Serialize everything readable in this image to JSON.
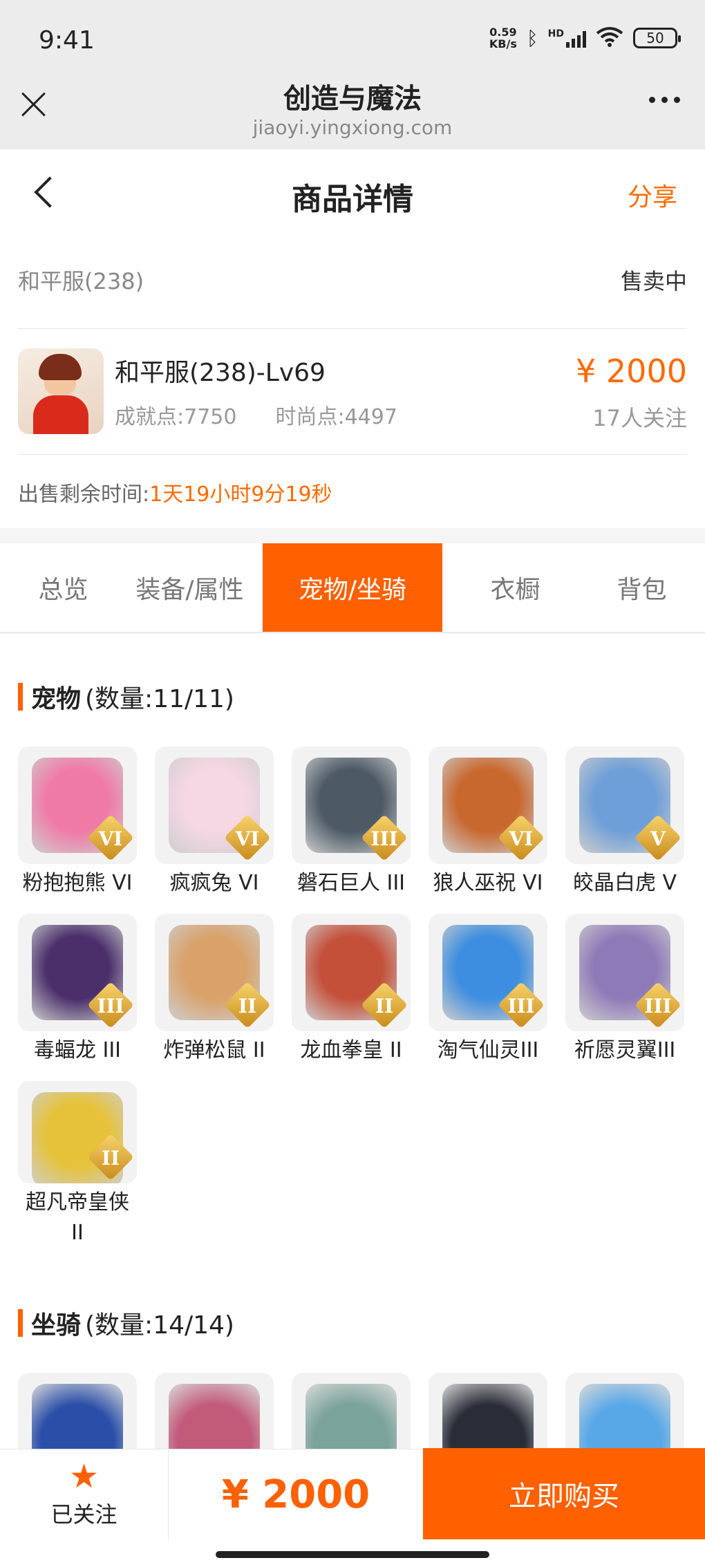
{
  "status_bar": {
    "time": "9:41",
    "net_speed": "0.59",
    "net_unit": "KB/s",
    "hd": "HD",
    "battery": "50"
  },
  "browser": {
    "title": "创造与魔法",
    "url": "jiaoyi.yingxiong.com"
  },
  "nav": {
    "title": "商品详情",
    "share": "分享"
  },
  "listing": {
    "server": "和平服(238)",
    "status": "售卖中",
    "char_name": "和平服(238)-Lv69",
    "achievement": "成就点:7750",
    "fashion": "时尚点:4497",
    "price": "¥ 2000",
    "followers": "17人关注",
    "time_left_label": "出售剩余时间:",
    "time_left_value": "1天19小时9分19秒"
  },
  "tabs": [
    "总览",
    "装备/属性",
    "宠物/坐骑",
    "衣橱",
    "背包"
  ],
  "active_tab": "宠物/坐骑",
  "pets": {
    "title": "宠物",
    "count": "(数量:11/11)",
    "items": [
      {
        "name": "粉抱抱熊 VI",
        "tier": "VI",
        "color": "#f07aa6"
      },
      {
        "name": "疯疯兔 VI",
        "tier": "VI",
        "color": "#f6d7e4"
      },
      {
        "name": "磐石巨人 III",
        "tier": "III",
        "color": "#4d5a66"
      },
      {
        "name": "狼人巫祝 VI",
        "tier": "VI",
        "color": "#c8682f"
      },
      {
        "name": "皎晶白虎 V",
        "tier": "V",
        "color": "#6f9fd8"
      },
      {
        "name": "毒蝠龙 III",
        "tier": "III",
        "color": "#4a2f6b"
      },
      {
        "name": "炸弹松鼠 II",
        "tier": "II",
        "color": "#d9a26b"
      },
      {
        "name": "龙血拳皇 II",
        "tier": "II",
        "color": "#c4503a"
      },
      {
        "name": "淘气仙灵III",
        "tier": "III",
        "color": "#3d8ee0"
      },
      {
        "name": "祈愿灵翼III",
        "tier": "III",
        "color": "#8f7ab8"
      },
      {
        "name": "超凡帝皇侠 II",
        "tier": "II",
        "color": "#e6c23a"
      }
    ]
  },
  "mounts": {
    "title": "坐骑",
    "count": "(数量:14/14)",
    "items": [
      {
        "color": "#2b4fa8"
      },
      {
        "color": "#c25a7a"
      },
      {
        "color": "#7aa39a"
      },
      {
        "color": "#2a2d38"
      },
      {
        "color": "#58a8e8"
      }
    ]
  },
  "bottom": {
    "follow_label": "已关注",
    "price": "¥ 2000",
    "buy_label": "立即购买"
  },
  "accent_color": "#ff6000"
}
